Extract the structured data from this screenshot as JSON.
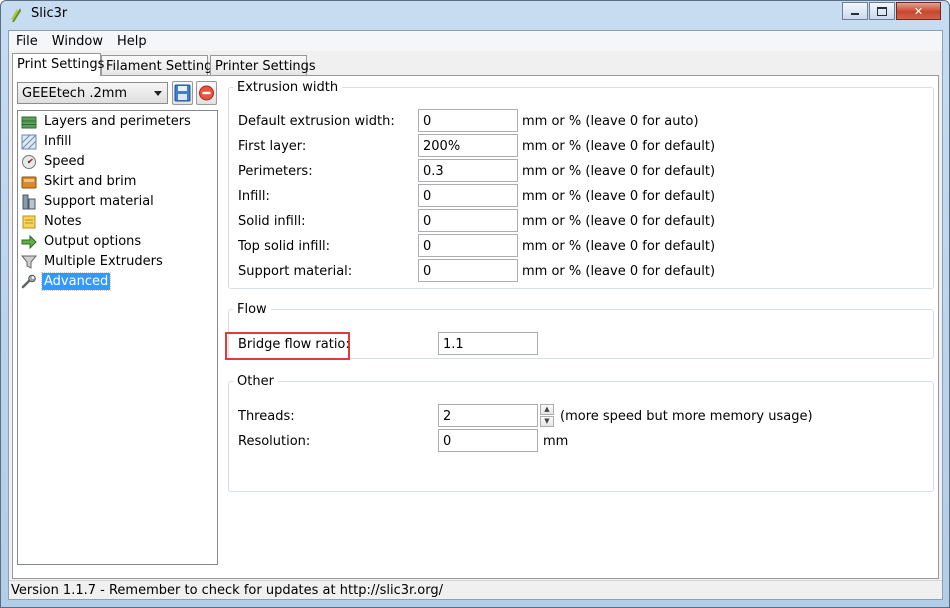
{
  "window": {
    "title": "Slic3r"
  },
  "menubar": [
    "File",
    "Window",
    "Help"
  ],
  "tabs": [
    {
      "label": "Print Settings",
      "active": true
    },
    {
      "label": "Filament Settings",
      "active": false
    },
    {
      "label": "Printer Settings",
      "active": false
    }
  ],
  "preset": {
    "selected": "GEEEtech .2mm"
  },
  "sidebar": {
    "items": [
      {
        "label": "Layers and perimeters",
        "icon": "layers-icon"
      },
      {
        "label": "Infill",
        "icon": "infill-icon"
      },
      {
        "label": "Speed",
        "icon": "speed-icon"
      },
      {
        "label": "Skirt and brim",
        "icon": "skirt-icon"
      },
      {
        "label": "Support material",
        "icon": "support-icon"
      },
      {
        "label": "Notes",
        "icon": "notes-icon"
      },
      {
        "label": "Output options",
        "icon": "output-icon"
      },
      {
        "label": "Multiple Extruders",
        "icon": "funnel-icon"
      },
      {
        "label": "Advanced",
        "icon": "wrench-icon",
        "selected": true
      }
    ]
  },
  "extrusion_width": {
    "title": "Extrusion width",
    "rows": [
      {
        "label": "Default extrusion width:",
        "value": "0",
        "unit": "mm or % (leave 0 for auto)"
      },
      {
        "label": "First layer:",
        "value": "200%",
        "unit": "mm or % (leave 0 for default)"
      },
      {
        "label": "Perimeters:",
        "value": "0.3",
        "unit": "mm or % (leave 0 for default)"
      },
      {
        "label": "Infill:",
        "value": "0",
        "unit": "mm or % (leave 0 for default)"
      },
      {
        "label": "Solid infill:",
        "value": "0",
        "unit": "mm or % (leave 0 for default)"
      },
      {
        "label": "Top solid infill:",
        "value": "0",
        "unit": "mm or % (leave 0 for default)"
      },
      {
        "label": "Support material:",
        "value": "0",
        "unit": "mm or % (leave 0 for default)"
      }
    ]
  },
  "flow": {
    "title": "Flow",
    "bridge_label": "Bridge flow ratio:",
    "bridge_value": "1.1"
  },
  "other": {
    "title": "Other",
    "threads_label": "Threads:",
    "threads_value": "2",
    "threads_unit": "(more speed but more memory usage)",
    "resolution_label": "Resolution:",
    "resolution_value": "0",
    "resolution_unit": "mm"
  },
  "status": {
    "text": "Version 1.1.7 - Remember to check for updates at http://slic3r.org/"
  },
  "colors": {
    "selection": "#3399ff",
    "highlight_box": "#e03a3a"
  }
}
